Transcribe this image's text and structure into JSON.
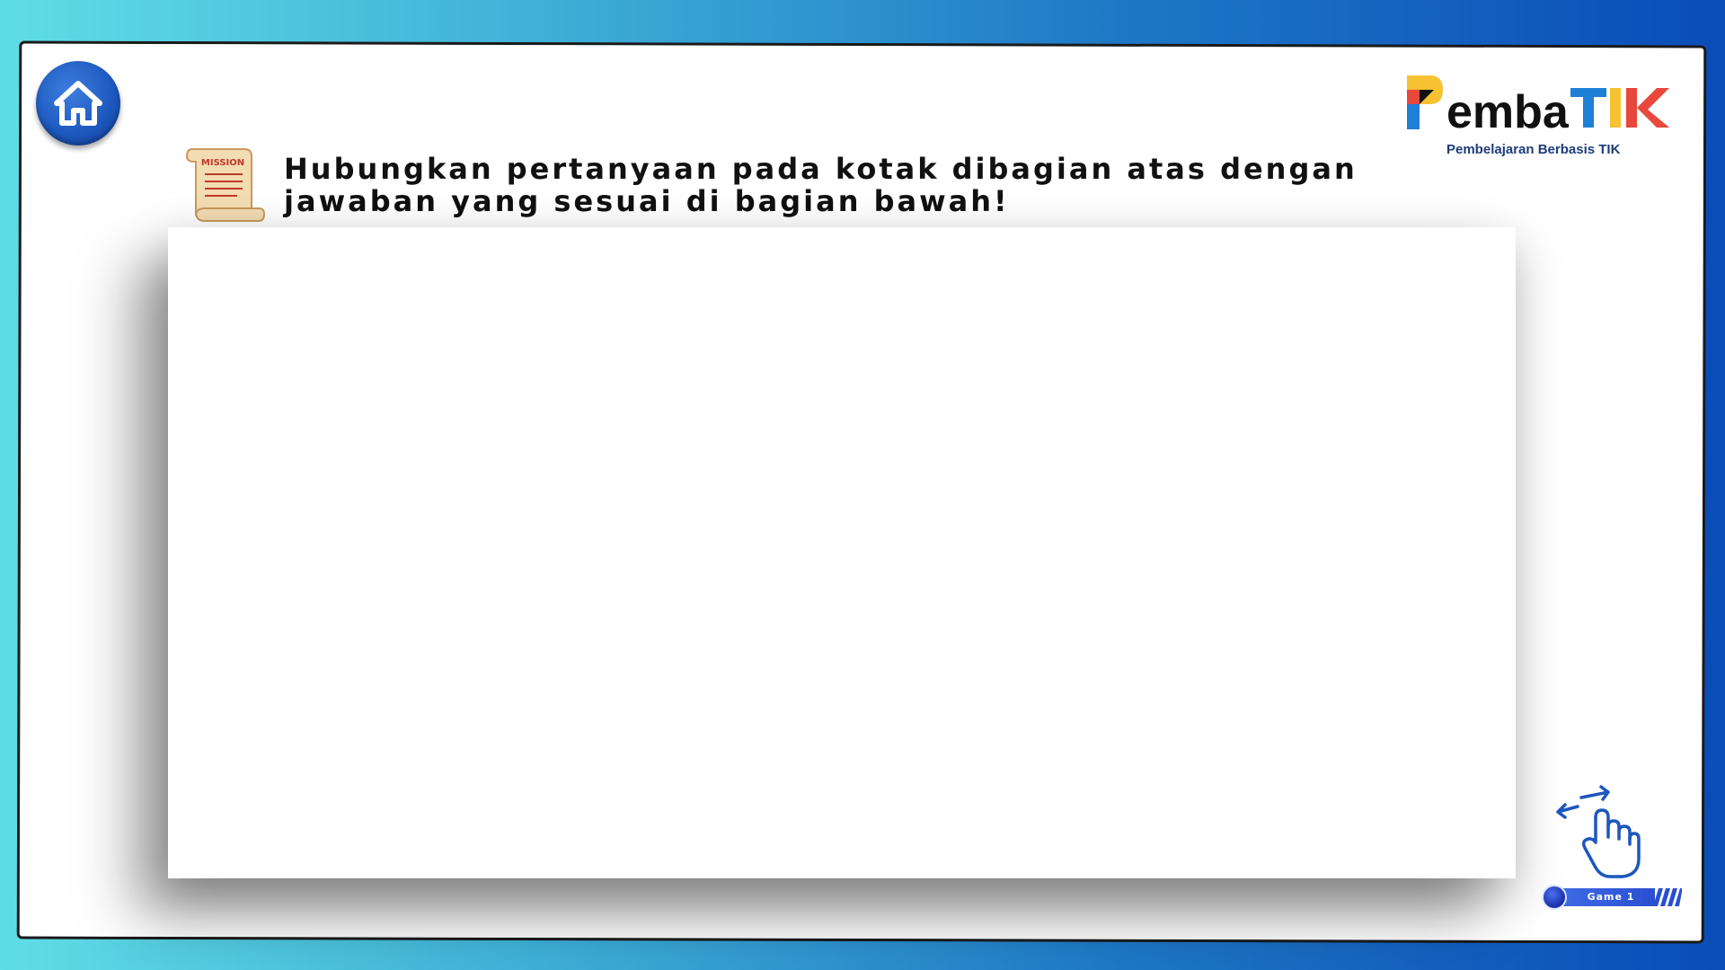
{
  "page": {
    "instruction": "Hubungkan pertanyaan pada kotak dibagian atas dengan jawaban yang sesuai di bagian bawah!"
  },
  "header": {
    "home_icon": "home-icon",
    "mission_icon": "mission-scroll-icon",
    "mission_label": "MISSION"
  },
  "logo": {
    "name": "PembaTIK",
    "subtitle": "Pembelajaran Berbasis TIK"
  },
  "footer": {
    "gesture_icon": "swipe-hand-icon",
    "game_label": "Game 1"
  },
  "colors": {
    "accent_blue": "#1c57bd",
    "background_start": "#5fdde6",
    "background_end": "#0a4cb8",
    "logo_yellow": "#f6c232",
    "logo_red": "#e8473b",
    "logo_blue": "#1e7fd6",
    "logo_black": "#111111"
  }
}
